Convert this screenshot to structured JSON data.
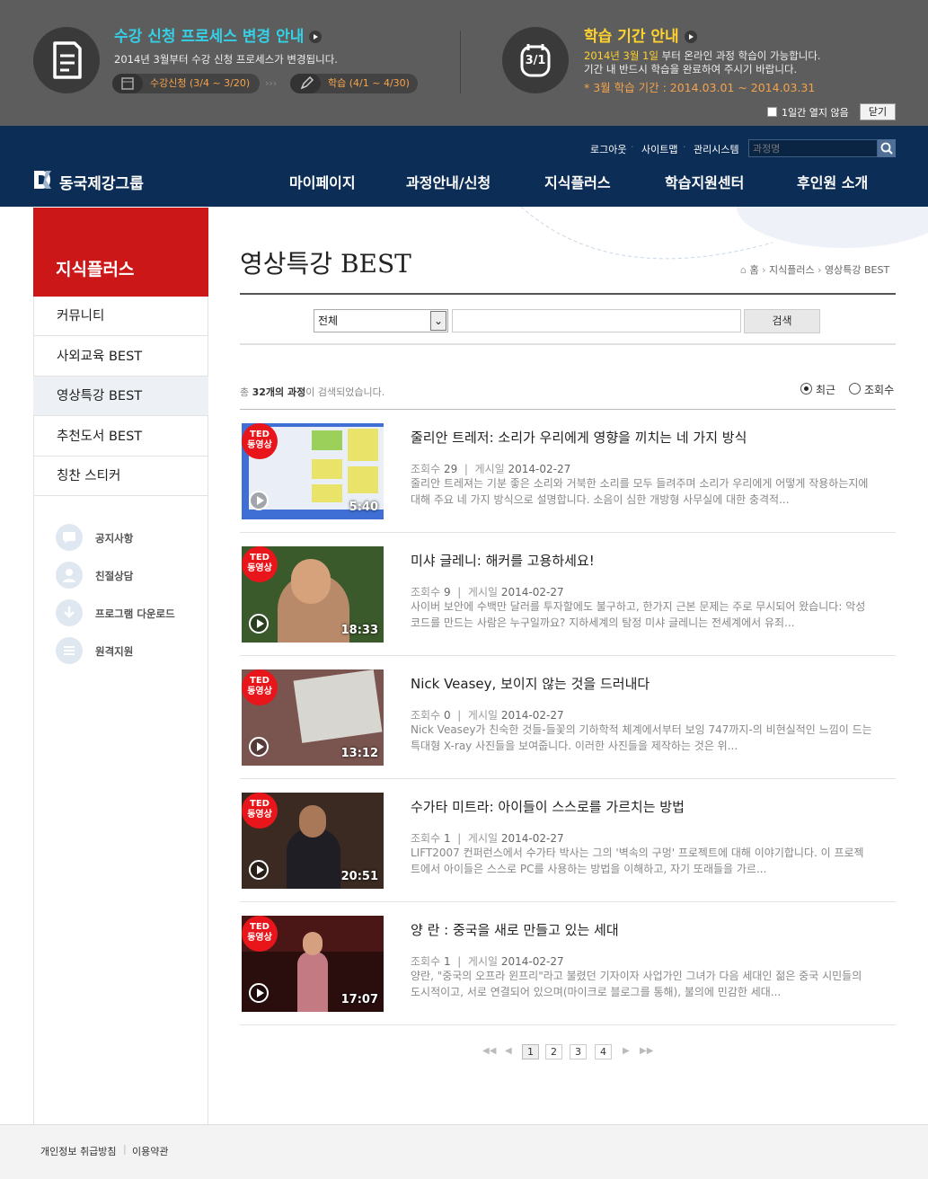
{
  "banner": {
    "left": {
      "title": "수강 신청 프로세스 변경 안내",
      "text": "2014년 3월부터 수강 신청 프로세스가 변경됩니다.",
      "pill1": "수강신청 (3/4 ~ 3/20)",
      "pill2": "학습 (4/1 ~ 4/30)"
    },
    "right": {
      "title": "학습 기간 안내",
      "icon_label": "3/1",
      "line1_em": "2014년 3월 1일",
      "line1_rest": " 부터 온라인 과정 학습이 가능합니다.",
      "line2": "기간 내 반드시 학습을 완료하여 주시기 바랍니다.",
      "line3": "* 3월 학습 기간 : 2014.03.01 ~ 2014.03.31"
    },
    "no_show_label": "1일간 열지 않음",
    "close_label": "닫기"
  },
  "header": {
    "logo": "동국제강그룹",
    "util": [
      "로그아웃",
      "사이트맵",
      "관리시스템"
    ],
    "search_placeholder": "과정명",
    "menu": [
      "마이페이지",
      "과정안내/신청",
      "지식플러스",
      "학습지원센터",
      "후인원 소개"
    ]
  },
  "sidebar": {
    "title": "지식플러스",
    "items": [
      "커뮤니티",
      "사외교육 BEST",
      "영상특강 BEST",
      "추천도서 BEST",
      "칭찬 스티커"
    ],
    "quick": [
      "공지사항",
      "친절상담",
      "프로그램 다운로드",
      "원격지원"
    ]
  },
  "page": {
    "title": "영상특강 BEST",
    "breadcrumb": [
      "홈",
      "지식플러스",
      "영상특강 BEST"
    ],
    "search": {
      "select_value": "전체",
      "button": "검색"
    },
    "result_prefix": "총 ",
    "result_count": "32개의 과정",
    "result_suffix": "이 검색되었습니다.",
    "sort": [
      "최근",
      "조회수"
    ]
  },
  "list": [
    {
      "badge": "TED\n동영상",
      "duration": "5:40",
      "title": "줄리안 트레저: 소리가 우리에게 영향을 끼치는 네 가지 방식",
      "views_label": "조회수",
      "views": "29",
      "date_label": "게시일",
      "date": "2014-02-27",
      "desc": "줄리안 트레져는 기분 좋은 소리와 거북한 소리를 모두 들려주며 소리가 우리에게 어떻게 작용하는지에 대해 주요 네 가지 방식으로 설명합니다. 소음이 심한 개방형 사무실에 대한 충격적..."
    },
    {
      "badge": "TED\n동영상",
      "duration": "18:33",
      "title": "미샤 글레니: 해커를 고용하세요!",
      "views_label": "조회수",
      "views": "9",
      "date_label": "게시일",
      "date": "2014-02-27",
      "desc": "사이버 보안에 수백만 달러를 투자할에도 불구하고, 한가지 근본 문제는 주로 무시되어 왔습니다: 악성 코드를 만드는 사람은 누구일까요? 지하세계의 탐정 미샤 글레니는 전세계에서 유죄..."
    },
    {
      "badge": "TED\n동영상",
      "duration": "13:12",
      "title": "Nick Veasey, 보이지 않는 것을 드러내다",
      "views_label": "조회수",
      "views": "0",
      "date_label": "게시일",
      "date": "2014-02-27",
      "desc": "Nick Veasey가 친숙한 것들-들꽃의 기하학적 체계에서부터 보잉 747까지-의 비현실적인 느낌이 드는 특대형 X-ray 사진들을 보여줍니다. 이러한 사진들을 제작하는 것은 위..."
    },
    {
      "badge": "TED\n동영상",
      "duration": "20:51",
      "title": "수가타 미트라: 아이들이 스스로를 가르치는 방법",
      "views_label": "조회수",
      "views": "1",
      "date_label": "게시일",
      "date": "2014-02-27",
      "desc": "LIFT2007 컨퍼런스에서 수가타 박사는 그의 '벽속의 구멍' 프로젝트에 대해 이야기합니다. 이 프로젝트에서 아이들은 스스로 PC를 사용하는 방법을 이해하고, 자기 또래들을 가르..."
    },
    {
      "badge": "TED\n동영상",
      "duration": "17:07",
      "title": "양 란 : 중국을 새로 만들고 있는 세대",
      "views_label": "조회수",
      "views": "1",
      "date_label": "게시일",
      "date": "2014-02-27",
      "desc": "양란, \"중국의 오프라 윈프리\"라고 불렸던 기자이자 사업가인 그녀가 다음 세대인 젊은 중국 시민들의 도시적이고, 서로 연결되어 있으며(마이크로 블로그를 통해), 불의에 민감한 세대..."
    }
  ],
  "pagination": [
    "1",
    "2",
    "3",
    "4"
  ],
  "footer": [
    "개인정보 취급방침",
    "이용약관"
  ],
  "colors": {
    "brand_red": "#cc1719",
    "navy": "#0c2d55",
    "banner_gray": "#5d5d5d",
    "cyan": "#35d0e6",
    "yellow": "#ffd22e",
    "orange": "#f5a34c"
  }
}
